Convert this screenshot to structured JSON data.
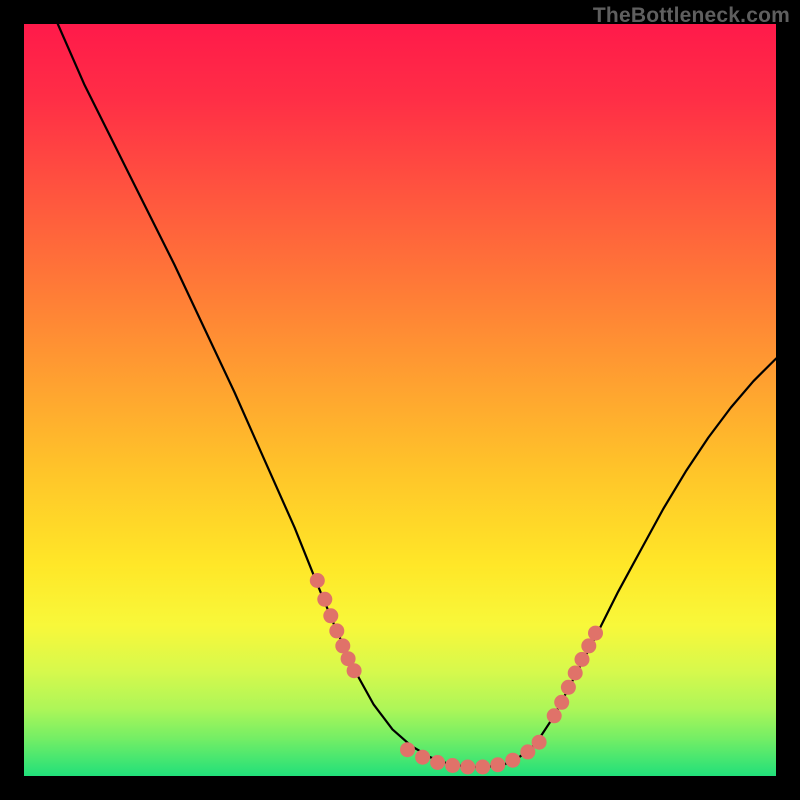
{
  "watermark": "TheBottleneck.com",
  "colors": {
    "frame_bg": "#000000",
    "curve": "#000000",
    "dots": "#e07269",
    "gradient_top": "#ff1a4a",
    "gradient_bottom": "#21e07a"
  },
  "chart_data": {
    "type": "line",
    "title": "",
    "xlabel": "",
    "ylabel": "",
    "xlim": [
      0,
      100
    ],
    "ylim": [
      0,
      100
    ],
    "grid": false,
    "legend": null,
    "curve_points": [
      {
        "x": 4.5,
        "y": 100.0
      },
      {
        "x": 8.0,
        "y": 92.0
      },
      {
        "x": 12.0,
        "y": 84.0
      },
      {
        "x": 16.0,
        "y": 76.0
      },
      {
        "x": 20.0,
        "y": 68.0
      },
      {
        "x": 24.0,
        "y": 59.5
      },
      {
        "x": 28.0,
        "y": 51.0
      },
      {
        "x": 32.0,
        "y": 42.0
      },
      {
        "x": 36.0,
        "y": 33.0
      },
      {
        "x": 39.0,
        "y": 25.5
      },
      {
        "x": 41.5,
        "y": 19.5
      },
      {
        "x": 44.0,
        "y": 14.0
      },
      {
        "x": 46.5,
        "y": 9.5
      },
      {
        "x": 49.0,
        "y": 6.2
      },
      {
        "x": 51.5,
        "y": 4.0
      },
      {
        "x": 54.0,
        "y": 2.5
      },
      {
        "x": 56.5,
        "y": 1.6
      },
      {
        "x": 59.0,
        "y": 1.2
      },
      {
        "x": 61.5,
        "y": 1.2
      },
      {
        "x": 64.0,
        "y": 1.6
      },
      {
        "x": 66.0,
        "y": 2.6
      },
      {
        "x": 68.0,
        "y": 4.2
      },
      {
        "x": 70.5,
        "y": 8.0
      },
      {
        "x": 73.0,
        "y": 12.8
      },
      {
        "x": 76.0,
        "y": 18.5
      },
      {
        "x": 79.0,
        "y": 24.5
      },
      {
        "x": 82.0,
        "y": 30.0
      },
      {
        "x": 85.0,
        "y": 35.5
      },
      {
        "x": 88.0,
        "y": 40.5
      },
      {
        "x": 91.0,
        "y": 45.0
      },
      {
        "x": 94.0,
        "y": 49.0
      },
      {
        "x": 97.0,
        "y": 52.5
      },
      {
        "x": 100.0,
        "y": 55.5
      }
    ],
    "left_cluster": [
      {
        "x": 39.0,
        "y": 26.0
      },
      {
        "x": 40.0,
        "y": 23.5
      },
      {
        "x": 40.8,
        "y": 21.3
      },
      {
        "x": 41.6,
        "y": 19.3
      },
      {
        "x": 42.4,
        "y": 17.3
      },
      {
        "x": 43.1,
        "y": 15.6
      },
      {
        "x": 43.9,
        "y": 14.0
      }
    ],
    "bottom_cluster": [
      {
        "x": 51.0,
        "y": 3.5
      },
      {
        "x": 53.0,
        "y": 2.5
      },
      {
        "x": 55.0,
        "y": 1.8
      },
      {
        "x": 57.0,
        "y": 1.4
      },
      {
        "x": 59.0,
        "y": 1.2
      },
      {
        "x": 61.0,
        "y": 1.2
      },
      {
        "x": 63.0,
        "y": 1.5
      },
      {
        "x": 65.0,
        "y": 2.1
      },
      {
        "x": 67.0,
        "y": 3.2
      },
      {
        "x": 68.5,
        "y": 4.5
      }
    ],
    "right_cluster": [
      {
        "x": 70.5,
        "y": 8.0
      },
      {
        "x": 71.5,
        "y": 9.8
      },
      {
        "x": 72.4,
        "y": 11.8
      },
      {
        "x": 73.3,
        "y": 13.7
      },
      {
        "x": 74.2,
        "y": 15.5
      },
      {
        "x": 75.1,
        "y": 17.3
      },
      {
        "x": 76.0,
        "y": 19.0
      }
    ]
  }
}
